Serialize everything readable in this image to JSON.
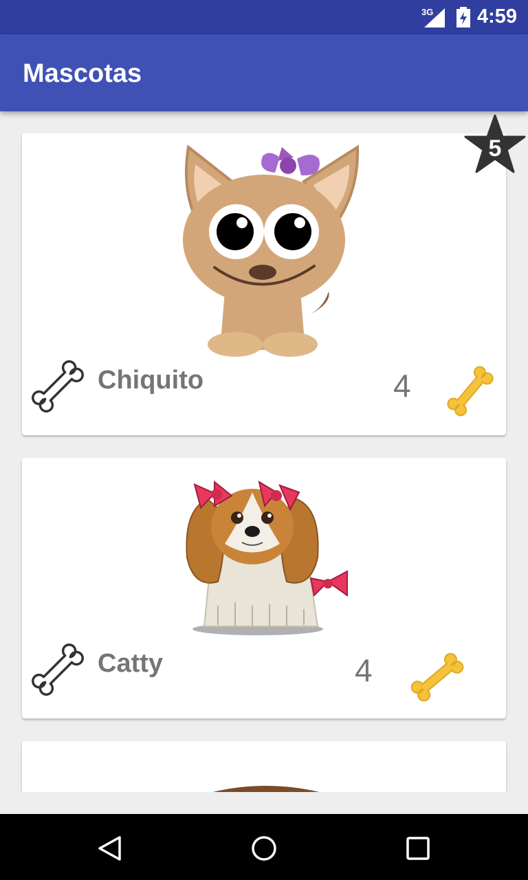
{
  "status_bar": {
    "network": "3G",
    "time": "4:59"
  },
  "app_bar": {
    "title": "Mascotas"
  },
  "rating_badge": {
    "value": "5"
  },
  "pets": [
    {
      "name": "Chiquito",
      "likes": "4"
    },
    {
      "name": "Catty",
      "likes": "4"
    },
    {
      "name": "",
      "likes": ""
    }
  ],
  "icons": {
    "like_button": "bone-outline-icon",
    "likes_indicator": "bone-yellow-icon",
    "nav_back": "back-triangle-icon",
    "nav_home": "home-circle-icon",
    "nav_recents": "recents-square-icon"
  },
  "colors": {
    "status_bar": "#303f9f",
    "app_bar": "#3f51b5",
    "background": "#eeeeee",
    "bone_yellow": "#f5c33b"
  }
}
